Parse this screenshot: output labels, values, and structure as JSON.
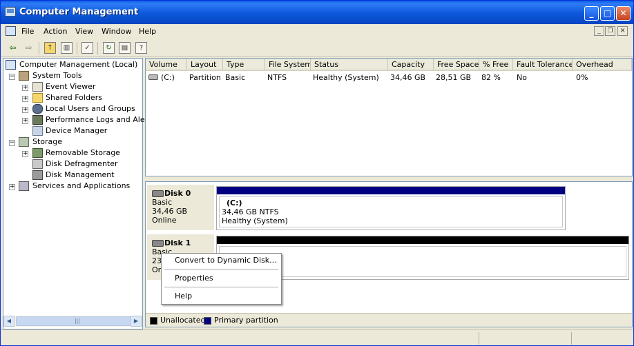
{
  "window": {
    "title": "Computer Management"
  },
  "menu": {
    "items": [
      "File",
      "Action",
      "View",
      "Window",
      "Help"
    ]
  },
  "tree": {
    "items": [
      {
        "label": "Computer Management (Local)"
      },
      {
        "label": "System Tools"
      },
      {
        "label": "Event Viewer"
      },
      {
        "label": "Shared Folders"
      },
      {
        "label": "Local Users and Groups"
      },
      {
        "label": "Performance Logs and Alerts"
      },
      {
        "label": "Device Manager"
      },
      {
        "label": "Storage"
      },
      {
        "label": "Removable Storage"
      },
      {
        "label": "Disk Defragmenter"
      },
      {
        "label": "Disk Management"
      },
      {
        "label": "Services and Applications"
      }
    ]
  },
  "volume_list": {
    "columns": [
      "Volume",
      "Layout",
      "Type",
      "File System",
      "Status",
      "Capacity",
      "Free Space",
      "% Free",
      "Fault Tolerance",
      "Overhead"
    ],
    "rows": [
      {
        "volume": "(C:)",
        "layout": "Partition",
        "type": "Basic",
        "fs": "NTFS",
        "status": "Healthy (System)",
        "capacity": "34,46 GB",
        "free": "28,51 GB",
        "pct": "82 %",
        "fault": "No",
        "overhead": "0%"
      }
    ]
  },
  "disks": {
    "disk0": {
      "name": "Disk 0",
      "type": "Basic",
      "size": "34,46 GB",
      "state": "Online",
      "partition": {
        "label": "(C:)",
        "size": "34,46 GB NTFS",
        "status": "Healthy (System)"
      }
    },
    "disk1": {
      "name": "Disk 1",
      "type": "Basic",
      "size": "23",
      "state": "On"
    }
  },
  "legend": {
    "unallocated": "Unallocated",
    "primary": "Primary partition",
    "unallocated_color": "#000000",
    "primary_color": "#000080"
  },
  "context_menu": {
    "items": [
      "Convert to Dynamic Disk...",
      "Properties",
      "Help"
    ]
  },
  "colors": {
    "title_blue": "#0b58db",
    "partition_bar": "#000080"
  }
}
